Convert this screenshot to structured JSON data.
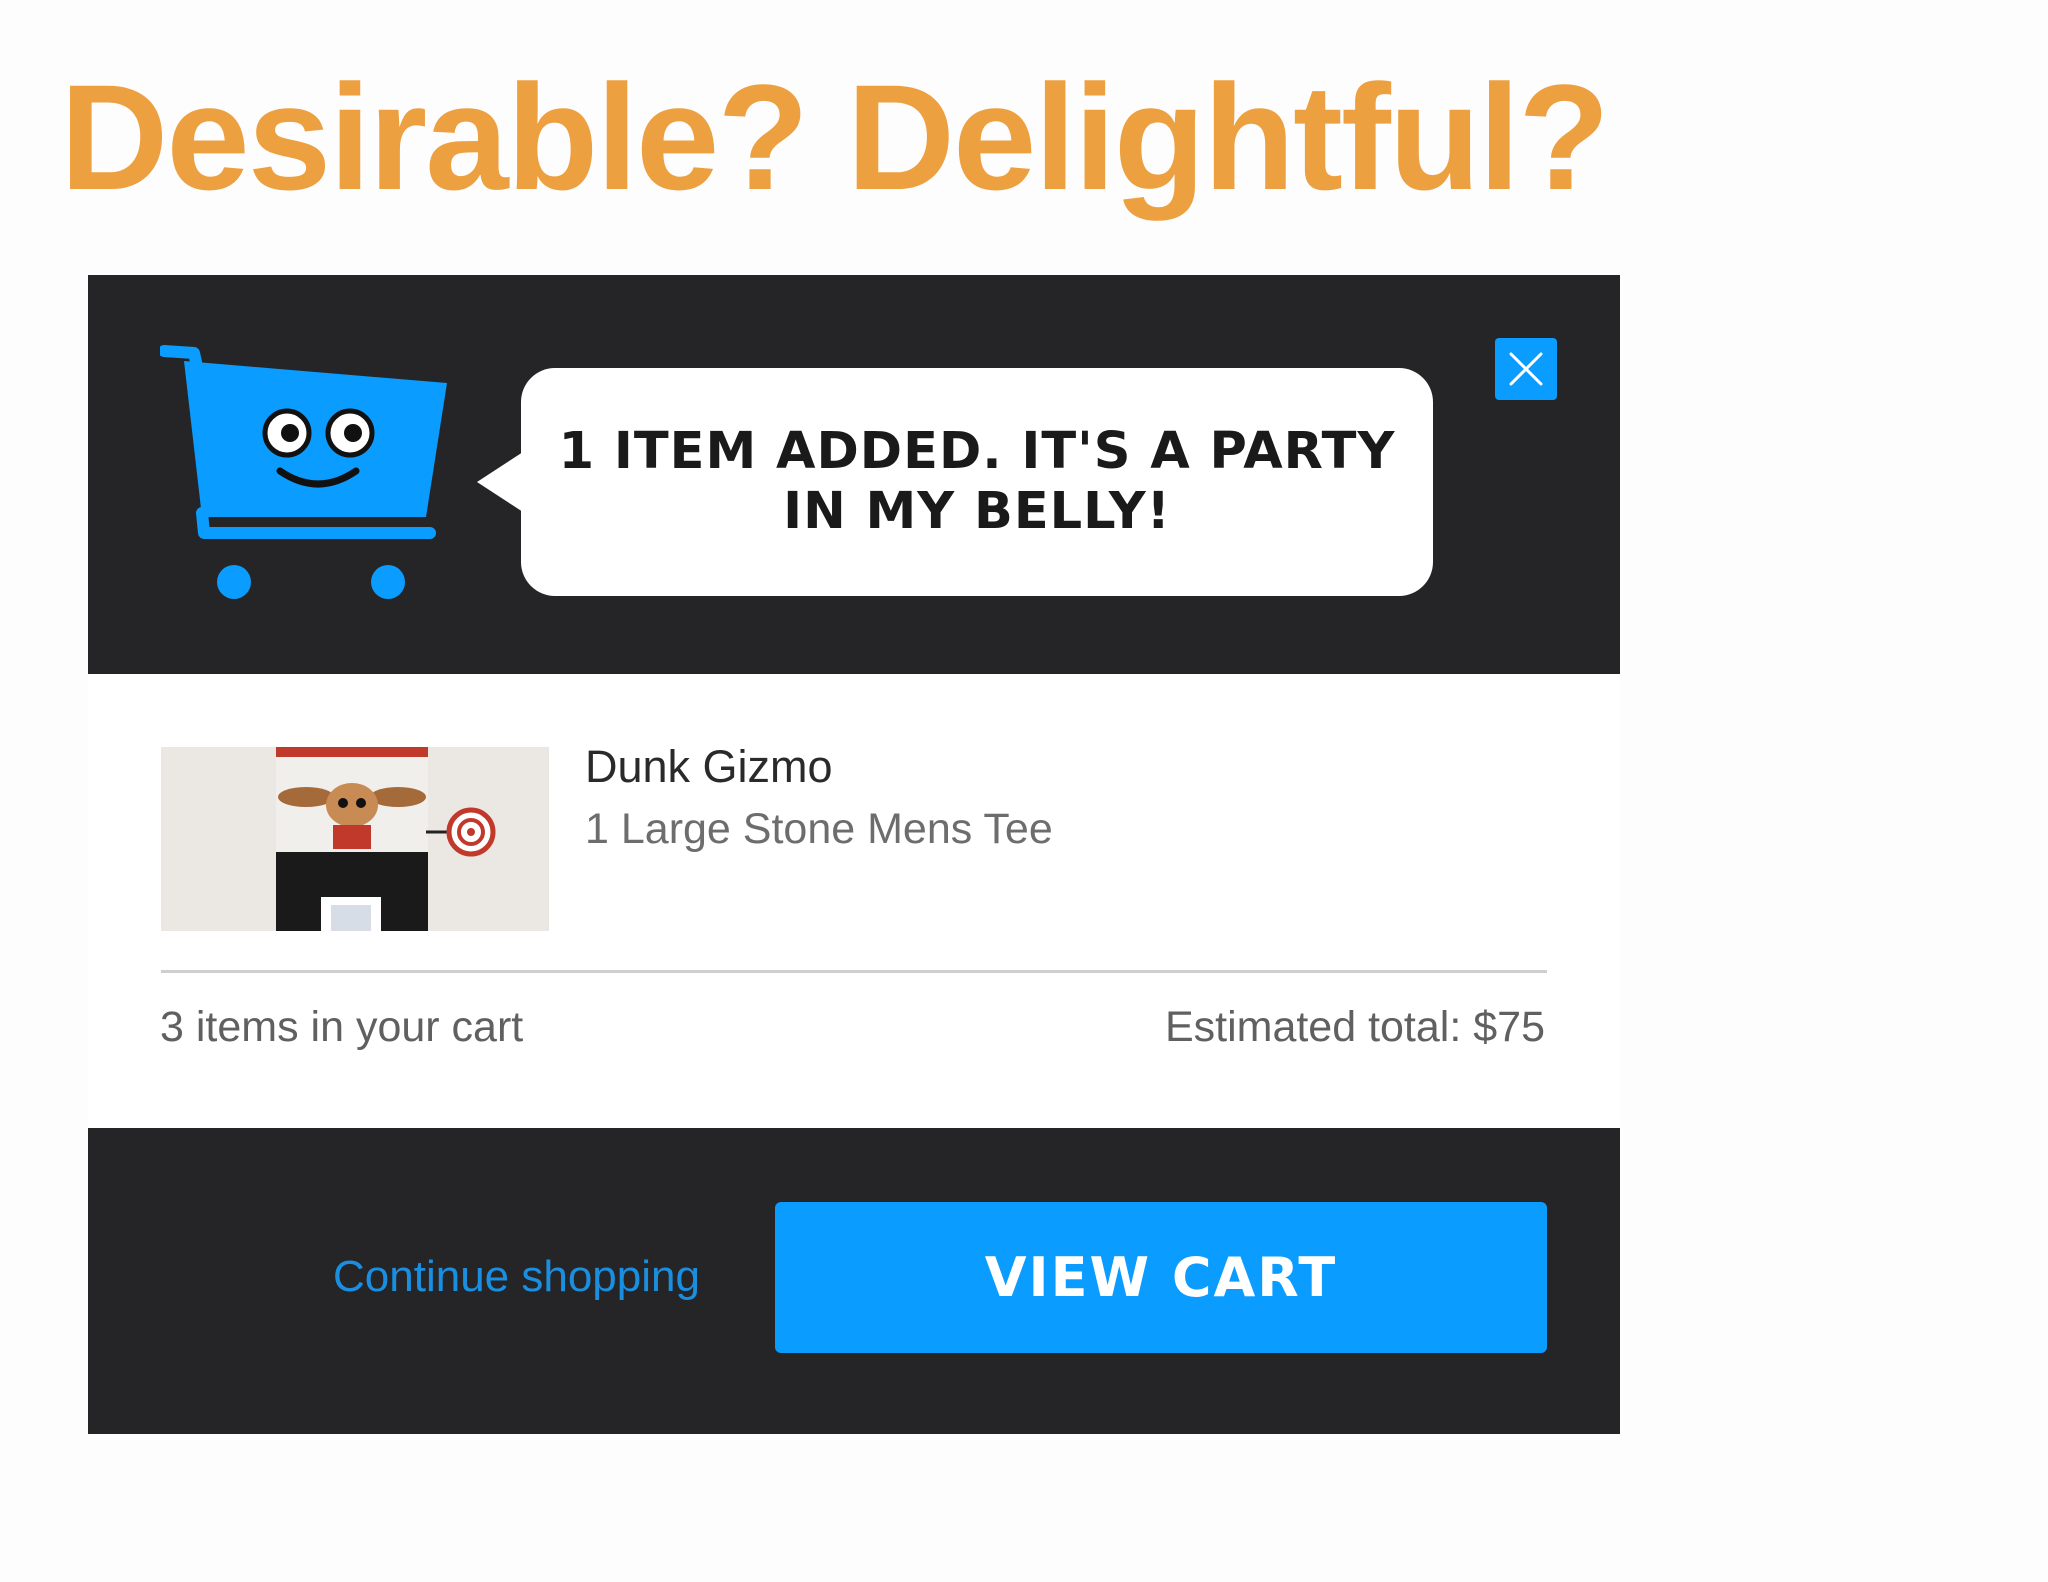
{
  "page": {
    "headline": "Desirable? Delightful?"
  },
  "modal": {
    "header": {
      "message": "1 ITEM ADDED. IT'S A PARTY IN MY BELLY!",
      "mascot_icon": "smiling-shopping-cart-icon",
      "close_icon": "close-icon"
    },
    "item": {
      "name": "Dunk Gizmo",
      "variant": "1 Large Stone Mens Tee",
      "thumbnail": "product-thumbnail-gizmo-tee"
    },
    "summary": {
      "cart_count": "3 items in your cart",
      "estimated_total": "Estimated total: $75"
    },
    "footer": {
      "continue_label": "Continue shopping",
      "view_cart_label": "VIEW CART"
    }
  },
  "colors": {
    "headline": "#eda040",
    "accent_blue": "#0a9cff",
    "dark_panel": "#252528"
  }
}
